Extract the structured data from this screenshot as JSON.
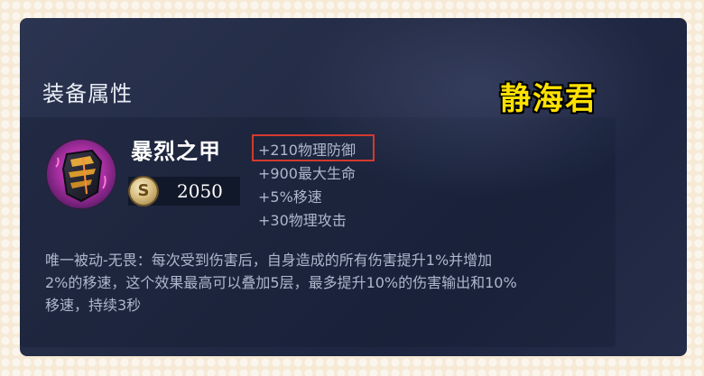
{
  "section": {
    "title": "装备属性"
  },
  "watermark": {
    "text": "静海君",
    "color": "#ffe100"
  },
  "item": {
    "name": "暴烈之甲",
    "icon": "armor-icon",
    "price_icon": "gold-coin-icon",
    "price": "2050",
    "stats": [
      "+210物理防御",
      "+900最大生命",
      "+5%移速",
      "+30物理攻击"
    ],
    "highlighted_stat_index": 0,
    "highlight_color": "#d23a2e",
    "passive_lines": [
      "唯一被动-无畏：每次受到伤害后，自身造成的所有伤害提升1%并增加",
      "2%的移速，这个效果最高可以叠加5层，最多提升10%的伤害输出和10%",
      "移速，持续3秒"
    ]
  }
}
